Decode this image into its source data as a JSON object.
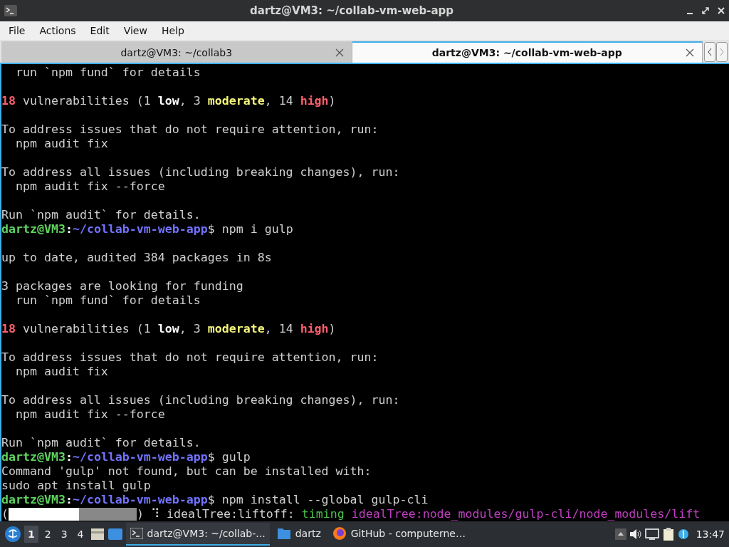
{
  "window": {
    "title": "dartz@VM3: ~/collab-vm-web-app"
  },
  "menu": [
    "File",
    "Actions",
    "Edit",
    "View",
    "Help"
  ],
  "tabs": [
    {
      "label": "dartz@VM3: ~/collab3",
      "selected": false
    },
    {
      "label": "dartz@VM3: ~/collab-vm-web-app",
      "selected": true
    }
  ],
  "terminal": {
    "lines": [
      {
        "kind": "text",
        "spans": [
          {
            "kind": "plain",
            "text": "  run `npm fund` for details"
          }
        ]
      },
      {
        "kind": "blank"
      },
      {
        "kind": "text",
        "spans": [
          {
            "kind": "red",
            "text": "18"
          },
          {
            "kind": "plain",
            "text": " vulnerabilities (1 "
          },
          {
            "kind": "bold",
            "text": "low"
          },
          {
            "kind": "plain",
            "text": ", 3 "
          },
          {
            "kind": "yellow",
            "text": "moderate"
          },
          {
            "kind": "plain",
            "text": ", 14 "
          },
          {
            "kind": "red",
            "text": "high"
          },
          {
            "kind": "plain",
            "text": ")"
          }
        ]
      },
      {
        "kind": "blank"
      },
      {
        "kind": "text",
        "spans": [
          {
            "kind": "plain",
            "text": "To address issues that do not require attention, run:"
          }
        ]
      },
      {
        "kind": "text",
        "spans": [
          {
            "kind": "plain",
            "text": "  npm audit fix"
          }
        ]
      },
      {
        "kind": "blank"
      },
      {
        "kind": "text",
        "spans": [
          {
            "kind": "plain",
            "text": "To address all issues (including breaking changes), run:"
          }
        ]
      },
      {
        "kind": "text",
        "spans": [
          {
            "kind": "plain",
            "text": "  npm audit fix --force"
          }
        ]
      },
      {
        "kind": "blank"
      },
      {
        "kind": "text",
        "spans": [
          {
            "kind": "plain",
            "text": "Run `npm audit` for details."
          }
        ]
      },
      {
        "kind": "text",
        "spans": [
          {
            "kind": "user",
            "text": "dartz@VM3"
          },
          {
            "kind": "bold",
            "text": ":"
          },
          {
            "kind": "path",
            "text": "~/collab-vm-web-app"
          },
          {
            "kind": "plain",
            "text": "$ npm i gulp"
          }
        ]
      },
      {
        "kind": "blank"
      },
      {
        "kind": "text",
        "spans": [
          {
            "kind": "plain",
            "text": "up to date, audited 384 packages in 8s"
          }
        ]
      },
      {
        "kind": "blank"
      },
      {
        "kind": "text",
        "spans": [
          {
            "kind": "plain",
            "text": "3 packages are looking for funding"
          }
        ]
      },
      {
        "kind": "text",
        "spans": [
          {
            "kind": "plain",
            "text": "  run `npm fund` for details"
          }
        ]
      },
      {
        "kind": "blank"
      },
      {
        "kind": "text",
        "spans": [
          {
            "kind": "red",
            "text": "18"
          },
          {
            "kind": "plain",
            "text": " vulnerabilities (1 "
          },
          {
            "kind": "bold",
            "text": "low"
          },
          {
            "kind": "plain",
            "text": ", 3 "
          },
          {
            "kind": "yellow",
            "text": "moderate"
          },
          {
            "kind": "plain",
            "text": ", 14 "
          },
          {
            "kind": "red",
            "text": "high"
          },
          {
            "kind": "plain",
            "text": ")"
          }
        ]
      },
      {
        "kind": "blank"
      },
      {
        "kind": "text",
        "spans": [
          {
            "kind": "plain",
            "text": "To address issues that do not require attention, run:"
          }
        ]
      },
      {
        "kind": "text",
        "spans": [
          {
            "kind": "plain",
            "text": "  npm audit fix"
          }
        ]
      },
      {
        "kind": "blank"
      },
      {
        "kind": "text",
        "spans": [
          {
            "kind": "plain",
            "text": "To address all issues (including breaking changes), run:"
          }
        ]
      },
      {
        "kind": "text",
        "spans": [
          {
            "kind": "plain",
            "text": "  npm audit fix --force"
          }
        ]
      },
      {
        "kind": "blank"
      },
      {
        "kind": "text",
        "spans": [
          {
            "kind": "plain",
            "text": "Run `npm audit` for details."
          }
        ]
      },
      {
        "kind": "text",
        "spans": [
          {
            "kind": "user",
            "text": "dartz@VM3"
          },
          {
            "kind": "bold",
            "text": ":"
          },
          {
            "kind": "path",
            "text": "~/collab-vm-web-app"
          },
          {
            "kind": "plain",
            "text": "$ gulp"
          }
        ]
      },
      {
        "kind": "text",
        "spans": [
          {
            "kind": "plain",
            "text": "Command 'gulp' not found, but can be installed with:"
          }
        ]
      },
      {
        "kind": "text",
        "spans": [
          {
            "kind": "plain",
            "text": "sudo apt install gulp"
          }
        ]
      },
      {
        "kind": "text",
        "spans": [
          {
            "kind": "user",
            "text": "dartz@VM3"
          },
          {
            "kind": "bold",
            "text": ":"
          },
          {
            "kind": "path",
            "text": "~/collab-vm-web-app"
          },
          {
            "kind": "plain",
            "text": "$ npm install --global gulp-cli"
          }
        ]
      },
      {
        "kind": "progress",
        "open": "(",
        "level": 0.55,
        "close": ")",
        "spans": [
          {
            "kind": "plain",
            "text": " ⠹ idealTree:liftoff: "
          },
          {
            "kind": "green",
            "text": "timing"
          },
          {
            "kind": "magenta",
            "text": " idealTree:node_modules/gulp-cli/node_modules/lift"
          }
        ]
      }
    ]
  },
  "taskbar": {
    "workspaces": [
      {
        "label": "1",
        "selected": true
      },
      {
        "label": "2",
        "selected": false
      },
      {
        "label": "3",
        "selected": false
      },
      {
        "label": "4",
        "selected": false
      }
    ],
    "tasks": [
      {
        "kind": "terminal",
        "label": "dartz@VM3: ~/collab-...",
        "selected": true
      },
      {
        "kind": "folder",
        "label": "dartz",
        "selected": false
      },
      {
        "kind": "browser",
        "label": "GitHub - computerne…",
        "selected": false
      }
    ],
    "clock": "13:47"
  }
}
